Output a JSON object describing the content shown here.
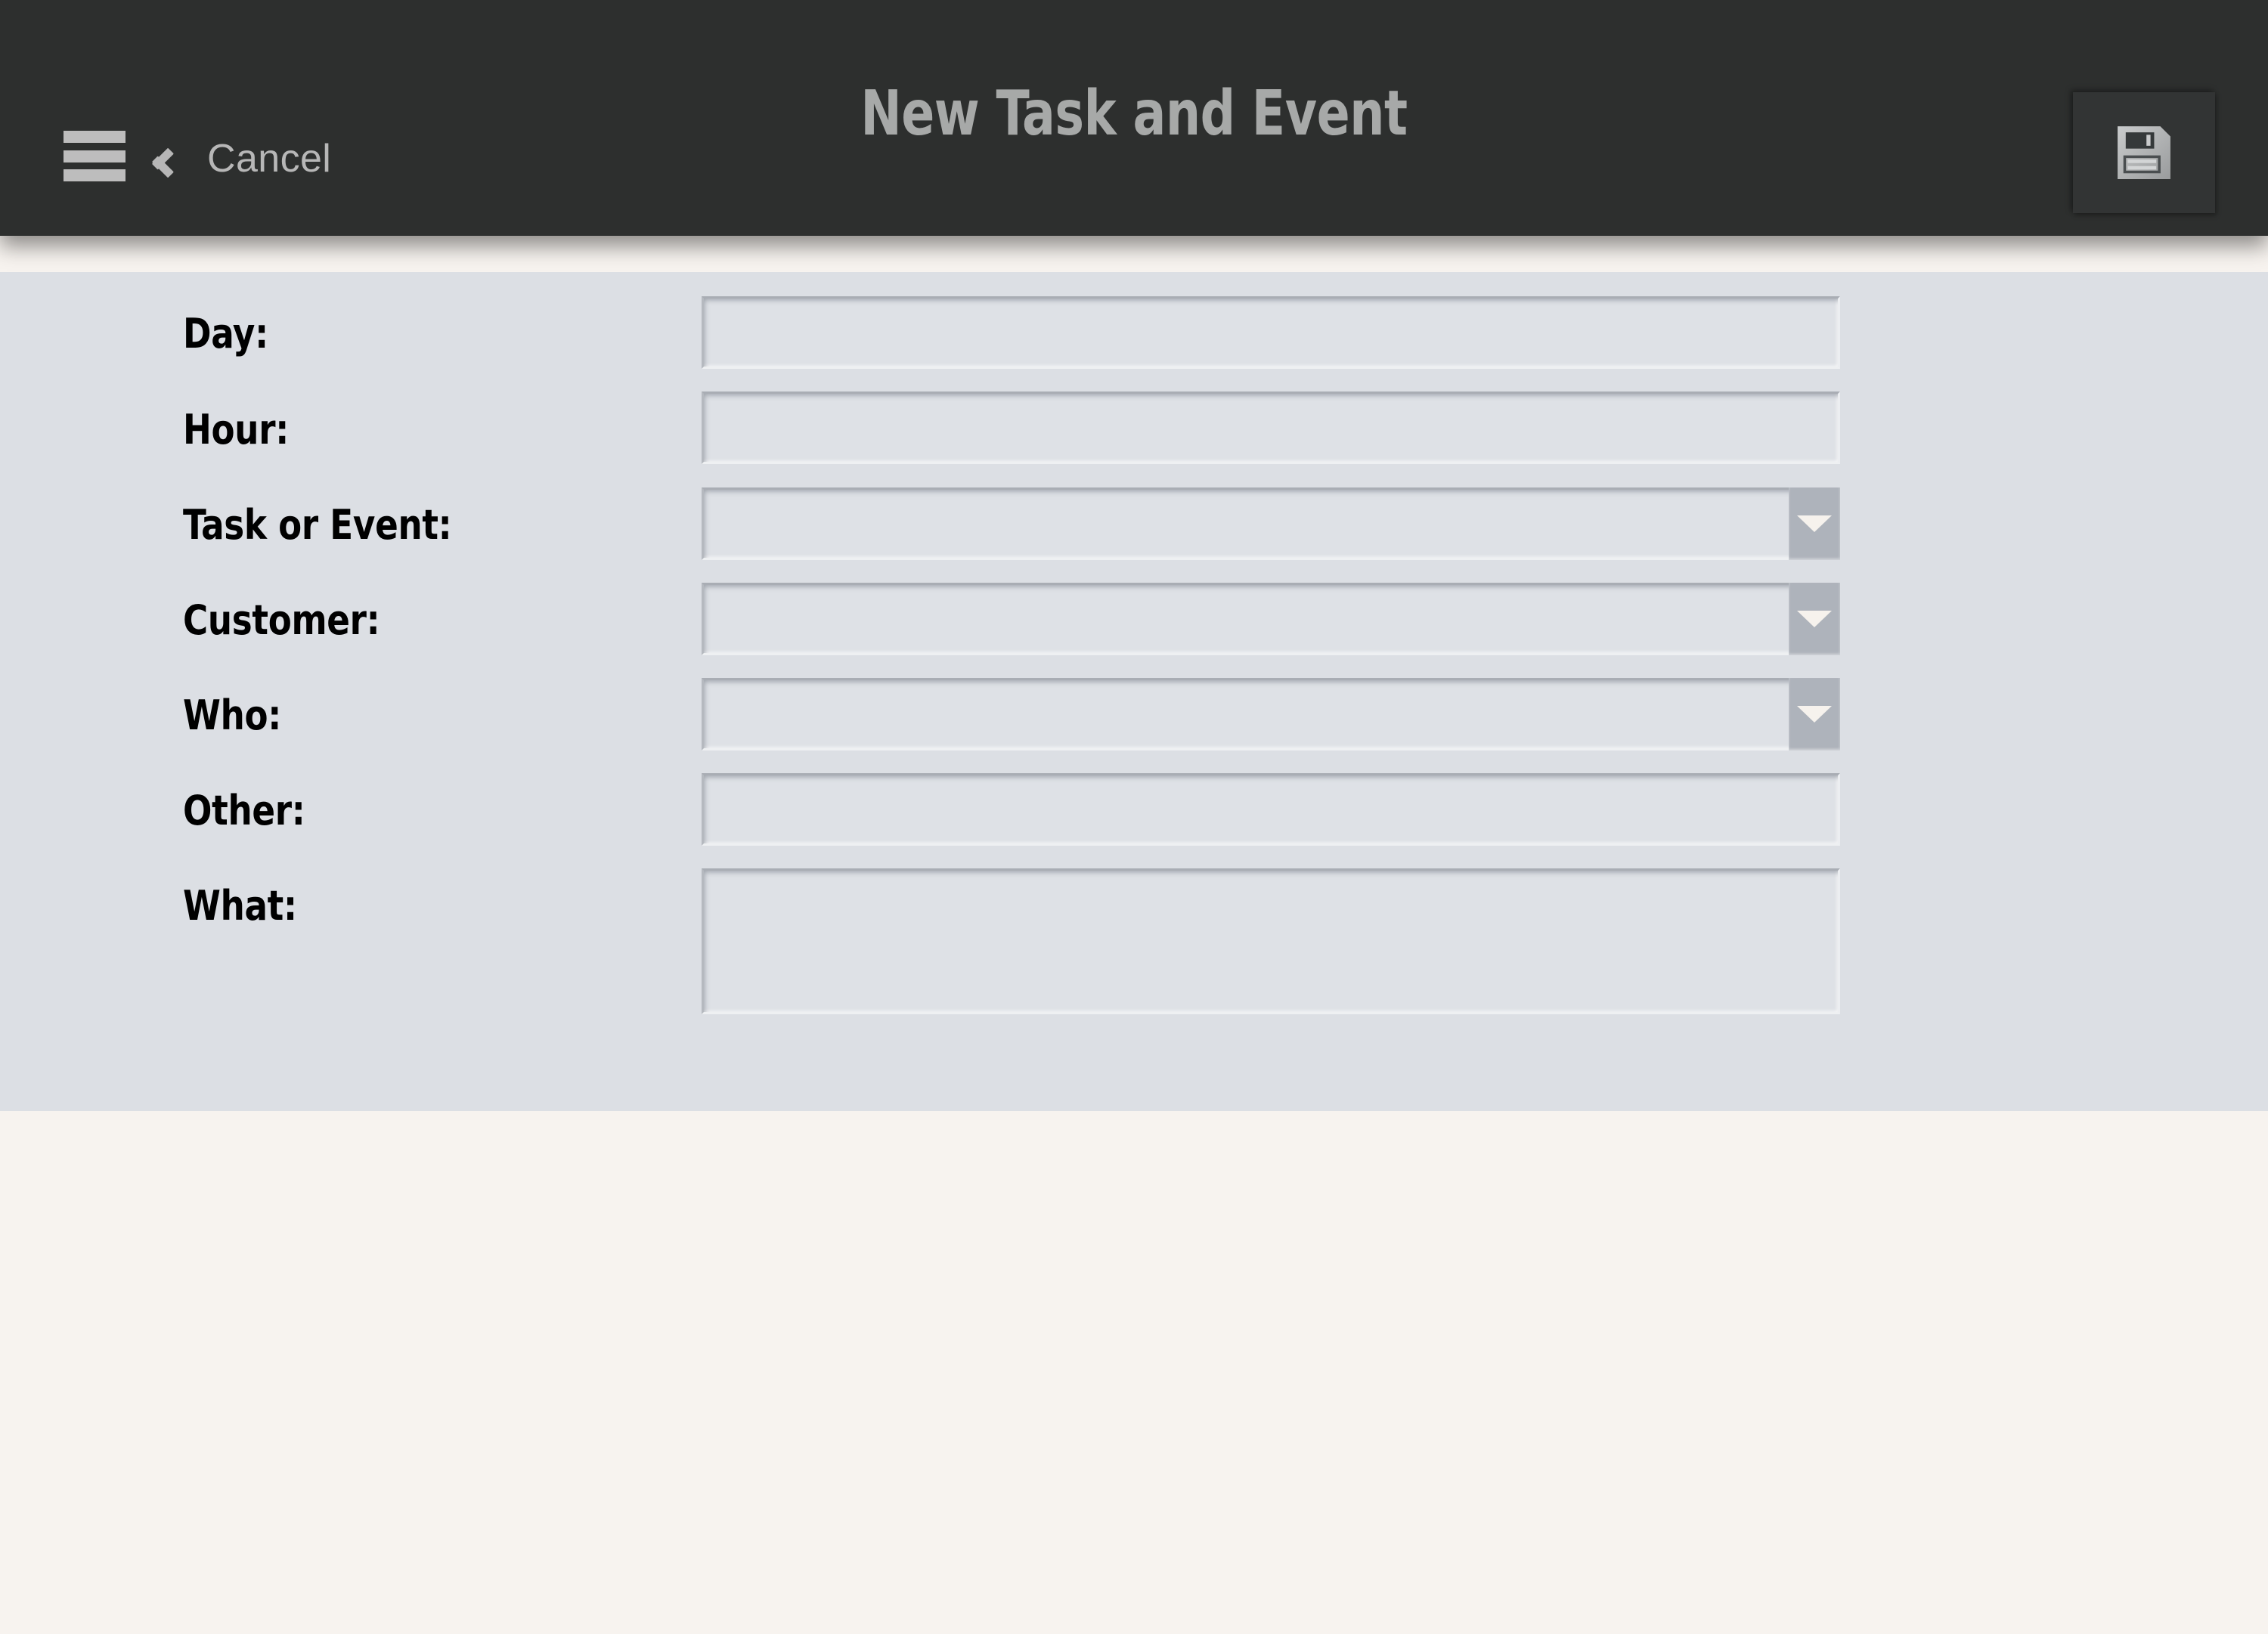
{
  "header": {
    "title": "New Task and Event",
    "menu_icon": "hamburger-menu-icon",
    "back_icon": "chevron-left-icon",
    "cancel_label": "Cancel",
    "save_icon": "floppy-disk-save-icon",
    "background_color": "#2d2f2e",
    "text_color": "#a7a9a8"
  },
  "form": {
    "background_color": "#dcdfe4",
    "fields": [
      {
        "label": "Day:",
        "value": "",
        "placeholder": "",
        "type": "text"
      },
      {
        "label": "Hour:",
        "value": "",
        "placeholder": "",
        "type": "text"
      },
      {
        "label": "Task or Event:",
        "value": "",
        "placeholder": "",
        "type": "select"
      },
      {
        "label": "Customer:",
        "value": "",
        "placeholder": "",
        "type": "select"
      },
      {
        "label": "Who:",
        "value": "",
        "placeholder": "",
        "type": "select"
      },
      {
        "label": "Other:",
        "value": "",
        "placeholder": "",
        "type": "text"
      },
      {
        "label": "What:",
        "value": "",
        "placeholder": "",
        "type": "textarea"
      }
    ]
  },
  "page": {
    "background_color": "#f7f3ef"
  }
}
